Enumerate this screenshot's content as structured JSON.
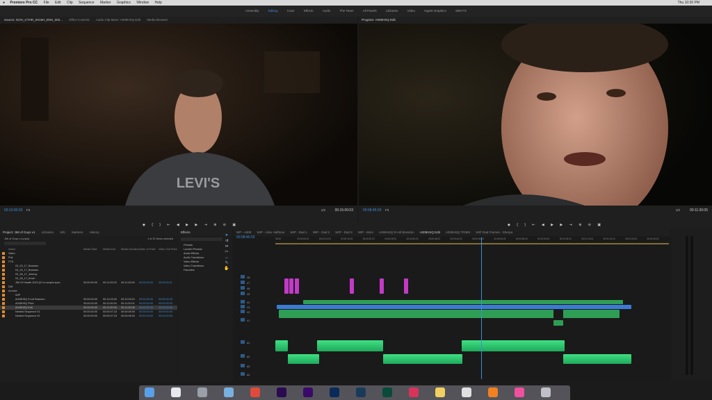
{
  "menubar": {
    "app": "Premiere Pro CC",
    "items": [
      "File",
      "Edit",
      "Clip",
      "Sequence",
      "Marker",
      "Graphics",
      "Window",
      "Help"
    ],
    "clock": "Thu 10:30 PM"
  },
  "workspaces": {
    "items": [
      "Assembly",
      "Editing",
      "Color",
      "Effects",
      "Audio",
      "The Team",
      "All Panels",
      "Libraries",
      "Video",
      "Ingest Graphics",
      "SBS FX"
    ],
    "active_index": 1
  },
  "source": {
    "tabs": [
      "Source: GOH_CTHR_2H15H_ENS_002...",
      "Effect Controls",
      "Audio Clip Mixer: A008HSQ Edit",
      "Media Browser"
    ],
    "timecode": "00:10:00:03",
    "fit": "Fit",
    "duration": "00:15:00:03",
    "scale": "1/2"
  },
  "program": {
    "tabs": [
      "Program: A008HSQ Edit"
    ],
    "timecode": "00:08:45:03",
    "fit": "Fit",
    "duration": "00:11:30:05",
    "scale": "1/2"
  },
  "project": {
    "tabs": [
      "Project: JMI of Guys v1",
      "Libraries",
      "Info",
      "Markers",
      "History"
    ],
    "filename": "JMI of Guys v1.prproj",
    "count": "1 of 22 items selected",
    "columns": [
      "Name",
      "Media Start",
      "Media End",
      "Media Duration",
      "Video In Point",
      "Video Out Point"
    ],
    "rows": [
      {
        "name": "Video",
        "start": "",
        "end": "",
        "dur": "",
        "in": "",
        "out": "",
        "selected": false
      },
      {
        "name": "Pull",
        "start": "",
        "end": "",
        "dur": "",
        "in": "",
        "out": "",
        "selected": false
      },
      {
        "name": "FTD",
        "start": "",
        "end": "",
        "dur": "",
        "in": "",
        "out": "",
        "selected": false
      },
      {
        "name": "03_23_17_Brandon",
        "start": "",
        "end": "",
        "dur": "",
        "in": "",
        "out": "",
        "selected": false
      },
      {
        "name": "03_23_17_Brandon",
        "start": "",
        "end": "",
        "dur": "",
        "in": "",
        "out": "",
        "selected": false
      },
      {
        "name": "03_28_17_Jeremy",
        "start": "",
        "end": "",
        "dur": "",
        "in": "",
        "out": "",
        "selected": false
      },
      {
        "name": "03_28_17_Kevin",
        "start": "",
        "end": "",
        "dur": "",
        "in": "",
        "out": "",
        "selected": false
      },
      {
        "name": "JMI Of Health 2023 (01 to scripts spec",
        "start": "00:00:00:00",
        "end": "00:11:29:23",
        "dur": "00:11:30:00",
        "in": "00:00:00:00",
        "out": "00:00:00:11",
        "selected": false
      },
      {
        "name": "DW",
        "start": "",
        "end": "",
        "dur": "",
        "in": "",
        "out": "",
        "selected": false
      },
      {
        "name": "Archive",
        "start": "",
        "end": "",
        "dur": "",
        "in": "",
        "out": "",
        "selected": false
      },
      {
        "name": "WIP",
        "start": "",
        "end": "",
        "dur": "",
        "in": "",
        "out": "",
        "selected": false
      },
      {
        "name": "A008HSQ R-roll Brandon",
        "start": "00:00:00:00",
        "end": "00:12:03:00",
        "dur": "00:12:03:01",
        "in": "00:00:00:00",
        "out": "00:00:00:03",
        "selected": false
      },
      {
        "name": "A008HSQ Pitch",
        "start": "00:00:00:00",
        "end": "00:11:00:00",
        "dur": "00:11:00:01",
        "in": "00:00:00:00",
        "out": "00:00:00:03",
        "selected": false
      },
      {
        "name": "A008HSQ Edit",
        "start": "00:00:00:00",
        "end": "00:11:30:05",
        "dur": "00:11:30:06",
        "in": "00:00:00:00",
        "out": "00:00:00:05",
        "selected": true
      },
      {
        "name": "Nested Sequence 01",
        "start": "00:00:00:00",
        "end": "00:00:07:23",
        "dur": "00:00:08:00",
        "in": "00:00:00:00",
        "out": "00:00:00:03",
        "selected": false
      },
      {
        "name": "Nested Sequence 02",
        "start": "00:00:00:00",
        "end": "00:00:07:23",
        "dur": "00:00:08:00",
        "in": "00:00:00:00",
        "out": "00:00:00:03",
        "selected": false
      }
    ]
  },
  "effects": {
    "title": "Effects",
    "items": [
      "Presets",
      "Lumetri Presets",
      "Audio Effects",
      "Audio Transitions",
      "Video Effects",
      "Video Transitions",
      "Favorites"
    ]
  },
  "timeline": {
    "tabs": [
      "WP - A008",
      "WIP - Alice Halftone",
      "WIP - Dad 1",
      "WIP - Dad 2",
      "WIP - Dad 3",
      "WIP - Mom",
      "A008HSQ R-roll Brandon",
      "A008HSQ Edit",
      "A008HSQ TRIMS",
      "WIP Dad Frames - Sherpa"
    ],
    "active_tab": 7,
    "timecode": "00:08:45:03",
    "ruler": [
      "00:00",
      "00:00:05:23",
      "00:00:10:23",
      "00:00:15:23",
      "00:00:20:23",
      "00:00:25:23",
      "00:00:30:23",
      "00:00:35:23",
      "00:00:40:23",
      "00:00:45:23",
      "00:00:50:23",
      "00:00:55:23",
      "00:01:00:23",
      "00:01:05:23",
      "00:01:10:23",
      "00:01:15:23",
      "00:01:20:23",
      "00:01:25:23"
    ],
    "tracks": [
      "V8",
      "V7",
      "V6",
      "V5",
      "V4",
      "V3",
      "V2",
      "V1",
      "A1",
      "A2",
      "A3",
      "A4"
    ],
    "audio_labels": [
      "Audio 1",
      "Audio 2",
      "Audio 3"
    ]
  },
  "colors": {
    "accent": "#3d8fd8",
    "video_clip": "#3b7bd6",
    "audio_clip": "#2fd07a",
    "nested_clip": "#c23ac6",
    "label": "#e08b2e"
  },
  "dock": {
    "icons": [
      "finder-icon",
      "safari-icon",
      "launchpad-icon",
      "mail-icon",
      "chrome-icon",
      "premiere-icon",
      "after-effects-icon",
      "photoshop-icon",
      "media-encoder-icon",
      "audition-icon",
      "davinci-icon",
      "notes-icon",
      "preview-icon",
      "vlc-icon",
      "itunes-icon",
      "trash-icon"
    ]
  }
}
